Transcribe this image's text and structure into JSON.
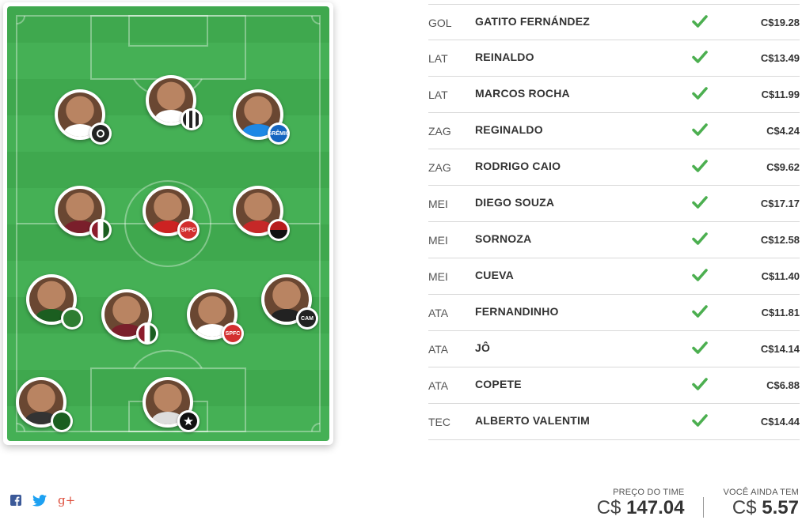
{
  "players": [
    {
      "position": "GOL",
      "name": "GATITO FERNÁNDEZ",
      "price": "C$19.28",
      "club": "botafogo-crest-icon",
      "shirt": "#222222",
      "crest": "#111111"
    },
    {
      "position": "LAT",
      "name": "REINALDO",
      "price": "C$13.49",
      "club": "sao-paulo-crest-icon",
      "shirt": "#cc2222",
      "crest": "#d32f2f"
    },
    {
      "position": "LAT",
      "name": "MARCOS ROCHA",
      "price": "C$11.99",
      "club": "atletico-mg-crest-icon",
      "shirt": "#222222",
      "crest": "#222222"
    },
    {
      "position": "ZAG",
      "name": "REGINALDO",
      "price": "C$4.24",
      "club": "fluminense-crest-icon",
      "shirt": "#7a1f2b",
      "crest": "#8c1c2c"
    },
    {
      "position": "ZAG",
      "name": "RODRIGO CAIO",
      "price": "C$9.62",
      "club": "sao-paulo-crest-icon",
      "shirt": "#ffffff",
      "crest": "#d32f2f"
    },
    {
      "position": "MEI",
      "name": "DIEGO SOUZA",
      "price": "C$17.17",
      "club": "sport-crest-icon",
      "shirt": "#c62828",
      "crest": "#b71c1c"
    },
    {
      "position": "MEI",
      "name": "SORNOZA",
      "price": "C$12.58",
      "club": "fluminense-crest-icon",
      "shirt": "#7a1f2b",
      "crest": "#8c1c2c"
    },
    {
      "position": "MEI",
      "name": "CUEVA",
      "price": "C$11.40",
      "club": "sao-paulo-crest-icon",
      "shirt": "#cc2222",
      "crest": "#d32f2f"
    },
    {
      "position": "ATA",
      "name": "FERNANDINHO",
      "price": "C$11.81",
      "club": "gremio-crest-icon",
      "shirt": "#1e88e5",
      "crest": "#1565c0"
    },
    {
      "position": "ATA",
      "name": "JÔ",
      "price": "C$14.14",
      "club": "corinthians-crest-icon",
      "shirt": "#ffffff",
      "crest": "#222222"
    },
    {
      "position": "ATA",
      "name": "COPETE",
      "price": "C$6.88",
      "club": "santos-crest-icon",
      "shirt": "#ffffff",
      "crest": "#222222"
    },
    {
      "position": "TEC",
      "name": "ALBERTO VALENTIM",
      "price": "C$14.44",
      "club": "palmeiras-crest-icon",
      "shirt": "#222222",
      "crest": "#1b5e20"
    }
  ],
  "crest_labels": {
    "sao_paulo": "SPFC",
    "gremio": "GRÊMIO",
    "atletico_mg": "CAM"
  },
  "footer": {
    "team_price_label": "PREÇO DO TIME",
    "team_price_currency": "C$",
    "team_price_value": "147.04",
    "remaining_label": "VOCÊ AINDA TEM",
    "remaining_currency": "C$",
    "remaining_value": "5.57"
  },
  "social": [
    "facebook-icon",
    "twitter-icon",
    "google-plus-icon"
  ],
  "colors": {
    "check": "#4caf50",
    "field_light": "#45b055",
    "field_dark": "#3fa84e",
    "facebook": "#3b5998",
    "twitter": "#1da1f2",
    "google_plus": "#dd4b39"
  }
}
